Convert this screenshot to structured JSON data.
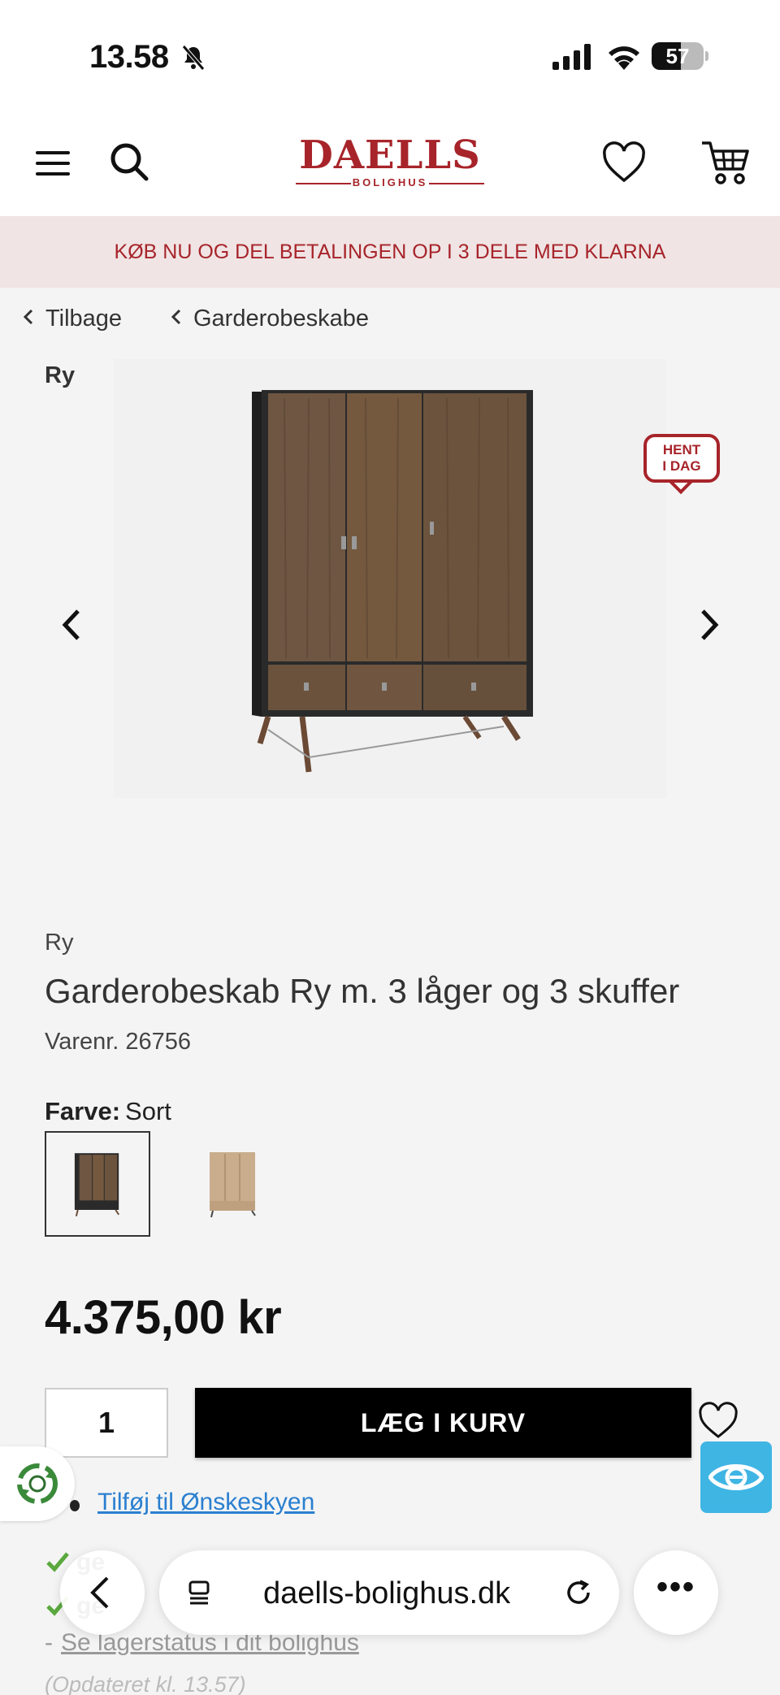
{
  "status_bar": {
    "time": "13.58",
    "battery": "57",
    "battery_level": 0.57
  },
  "header": {
    "logo_main": "DAELLS",
    "logo_sub": "BOLIGHUS",
    "icons": [
      "menu-icon",
      "search-icon",
      "heart-icon",
      "cart-icon"
    ]
  },
  "promo_banner": "KØB NU OG DEL BETALINGEN OP I 3 DELE MED KLARNA",
  "breadcrumbs": {
    "back": "Tilbage",
    "category": "Garderobeskabe"
  },
  "gallery": {
    "brand_overlay": "Ry",
    "badge_line1": "HENT",
    "badge_line2": "I DAG"
  },
  "product": {
    "brand": "Ry",
    "title": "Garderobeskab Ry m. 3 låger og 3 skuffer",
    "sku_label": "Varenr.",
    "sku": "26756",
    "color_label": "Farve:",
    "color_value": "Sort",
    "price": "4.375,00 kr",
    "quantity": "1",
    "add_to_cart": "LÆG I KURV",
    "wishlist_link": "Tilføj til Ønskeskyen"
  },
  "stock": {
    "line1_partial": "ge",
    "line2_partial": "ge",
    "lager_link": "Se lagerstatus i dit bolighus",
    "updated": "(Opdateret kl. 13.57)"
  },
  "browser": {
    "url": "daells-bolighus.dk",
    "more": "•••"
  },
  "colors": {
    "brand_red": "#a7242a",
    "link_blue": "#2a7fd0",
    "accessibility_blue": "#3fb5e4",
    "stock_green": "#5aa83e"
  }
}
